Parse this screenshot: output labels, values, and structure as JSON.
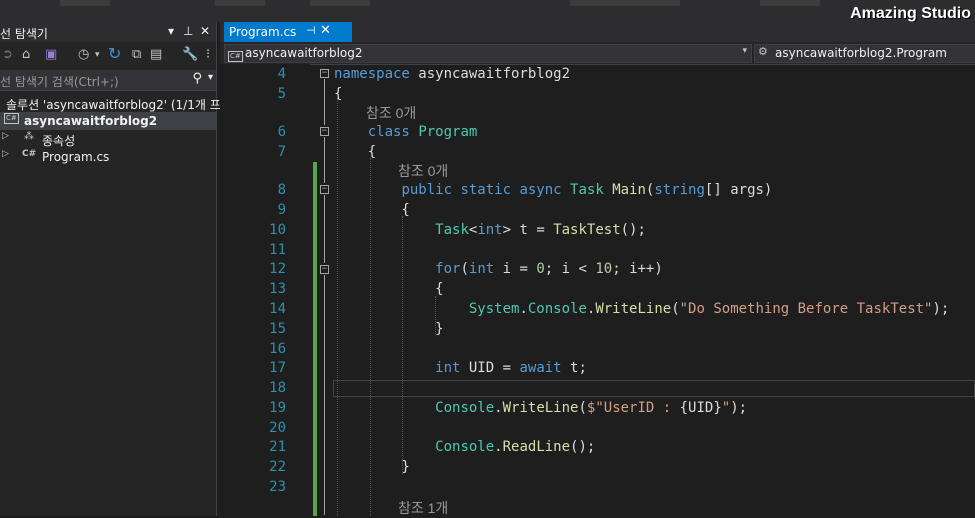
{
  "watermark": "Amazing Studio",
  "explorer": {
    "title": "선 탐색기",
    "title_controls": [
      "▾",
      "⊥",
      "✕"
    ],
    "search_placeholder": "선 탐색기 검색(Ctrl+;)",
    "solution_label": "솔루션 'asyncawaitforblog2' (1/1개 프로",
    "project_label": "asyncawaitforblog2",
    "items": [
      {
        "label": "종속성"
      },
      {
        "label": "Program.cs"
      }
    ]
  },
  "editor": {
    "tab_label": "Program.cs",
    "nav_left": "asyncawaitforblog2",
    "nav_right": "asyncawaitforblog2.Program",
    "refs": [
      "참조 0개",
      "참조 0개",
      "참조 1개"
    ]
  },
  "code_lines": [
    {
      "n": "4",
      "segs": [
        {
          "c": "kw",
          "t": "namespace"
        },
        {
          "c": "pl",
          "t": " asyncawaitforblog2"
        }
      ]
    },
    {
      "n": "5",
      "segs": [
        {
          "c": "pl",
          "t": "{"
        }
      ]
    },
    {
      "n": "6",
      "segs": [
        {
          "c": "pl",
          "t": "    "
        },
        {
          "c": "kw",
          "t": "class"
        },
        {
          "c": "pl",
          "t": " "
        },
        {
          "c": "ty",
          "t": "Program"
        }
      ]
    },
    {
      "n": "7",
      "segs": [
        {
          "c": "pl",
          "t": "    {"
        }
      ]
    },
    {
      "n": "8",
      "segs": [
        {
          "c": "pl",
          "t": "        "
        },
        {
          "c": "kw",
          "t": "public static async"
        },
        {
          "c": "pl",
          "t": " "
        },
        {
          "c": "ty",
          "t": "Task"
        },
        {
          "c": "pl",
          "t": " "
        },
        {
          "c": "fn",
          "t": "Main"
        },
        {
          "c": "pl",
          "t": "("
        },
        {
          "c": "kw",
          "t": "string"
        },
        {
          "c": "pl",
          "t": "[] args)"
        }
      ]
    },
    {
      "n": "9",
      "segs": [
        {
          "c": "pl",
          "t": "        {"
        }
      ]
    },
    {
      "n": "10",
      "segs": [
        {
          "c": "pl",
          "t": "            "
        },
        {
          "c": "ty",
          "t": "Task"
        },
        {
          "c": "pl",
          "t": "<"
        },
        {
          "c": "kw",
          "t": "int"
        },
        {
          "c": "pl",
          "t": "> t = "
        },
        {
          "c": "fn",
          "t": "TaskTest"
        },
        {
          "c": "pl",
          "t": "();"
        }
      ]
    },
    {
      "n": "11",
      "segs": []
    },
    {
      "n": "12",
      "segs": [
        {
          "c": "pl",
          "t": "            "
        },
        {
          "c": "kw",
          "t": "for"
        },
        {
          "c": "pl",
          "t": "("
        },
        {
          "c": "kw",
          "t": "int"
        },
        {
          "c": "pl",
          "t": " i = "
        },
        {
          "c": "nm",
          "t": "0"
        },
        {
          "c": "pl",
          "t": "; i < "
        },
        {
          "c": "nm",
          "t": "10"
        },
        {
          "c": "pl",
          "t": "; i++)"
        }
      ]
    },
    {
      "n": "13",
      "segs": [
        {
          "c": "pl",
          "t": "            {"
        }
      ]
    },
    {
      "n": "14",
      "segs": [
        {
          "c": "pl",
          "t": "                "
        },
        {
          "c": "ty",
          "t": "System"
        },
        {
          "c": "pl",
          "t": "."
        },
        {
          "c": "ty",
          "t": "Console"
        },
        {
          "c": "pl",
          "t": "."
        },
        {
          "c": "fn",
          "t": "WriteLine"
        },
        {
          "c": "pl",
          "t": "("
        },
        {
          "c": "str",
          "t": "\"Do Something Before TaskTest\""
        },
        {
          "c": "pl",
          "t": ");"
        }
      ]
    },
    {
      "n": "15",
      "segs": [
        {
          "c": "pl",
          "t": "            }"
        }
      ]
    },
    {
      "n": "16",
      "segs": []
    },
    {
      "n": "17",
      "segs": [
        {
          "c": "pl",
          "t": "            "
        },
        {
          "c": "kw",
          "t": "int"
        },
        {
          "c": "pl",
          "t": " UID = "
        },
        {
          "c": "kw",
          "t": "await"
        },
        {
          "c": "pl",
          "t": " t;"
        }
      ]
    },
    {
      "n": "18",
      "segs": []
    },
    {
      "n": "19",
      "segs": [
        {
          "c": "pl",
          "t": "            "
        },
        {
          "c": "ty",
          "t": "Console"
        },
        {
          "c": "pl",
          "t": "."
        },
        {
          "c": "fn",
          "t": "WriteLine"
        },
        {
          "c": "pl",
          "t": "("
        },
        {
          "c": "str",
          "t": "$\"UserID : "
        },
        {
          "c": "pl",
          "t": "{UID}"
        },
        {
          "c": "str",
          "t": "\""
        },
        {
          "c": "pl",
          "t": ");"
        }
      ]
    },
    {
      "n": "20",
      "segs": []
    },
    {
      "n": "21",
      "segs": [
        {
          "c": "pl",
          "t": "            "
        },
        {
          "c": "ty",
          "t": "Console"
        },
        {
          "c": "pl",
          "t": "."
        },
        {
          "c": "fn",
          "t": "ReadLine"
        },
        {
          "c": "pl",
          "t": "();"
        }
      ]
    },
    {
      "n": "22",
      "segs": [
        {
          "c": "pl",
          "t": "        }"
        }
      ]
    },
    {
      "n": "23",
      "segs": []
    }
  ],
  "colors": {
    "accent": "#007acc",
    "changed_bar": "#57a64a",
    "line_number": "#2b91af",
    "keyword": "#569cd6",
    "type": "#4ec9b0",
    "string": "#d69d85"
  }
}
